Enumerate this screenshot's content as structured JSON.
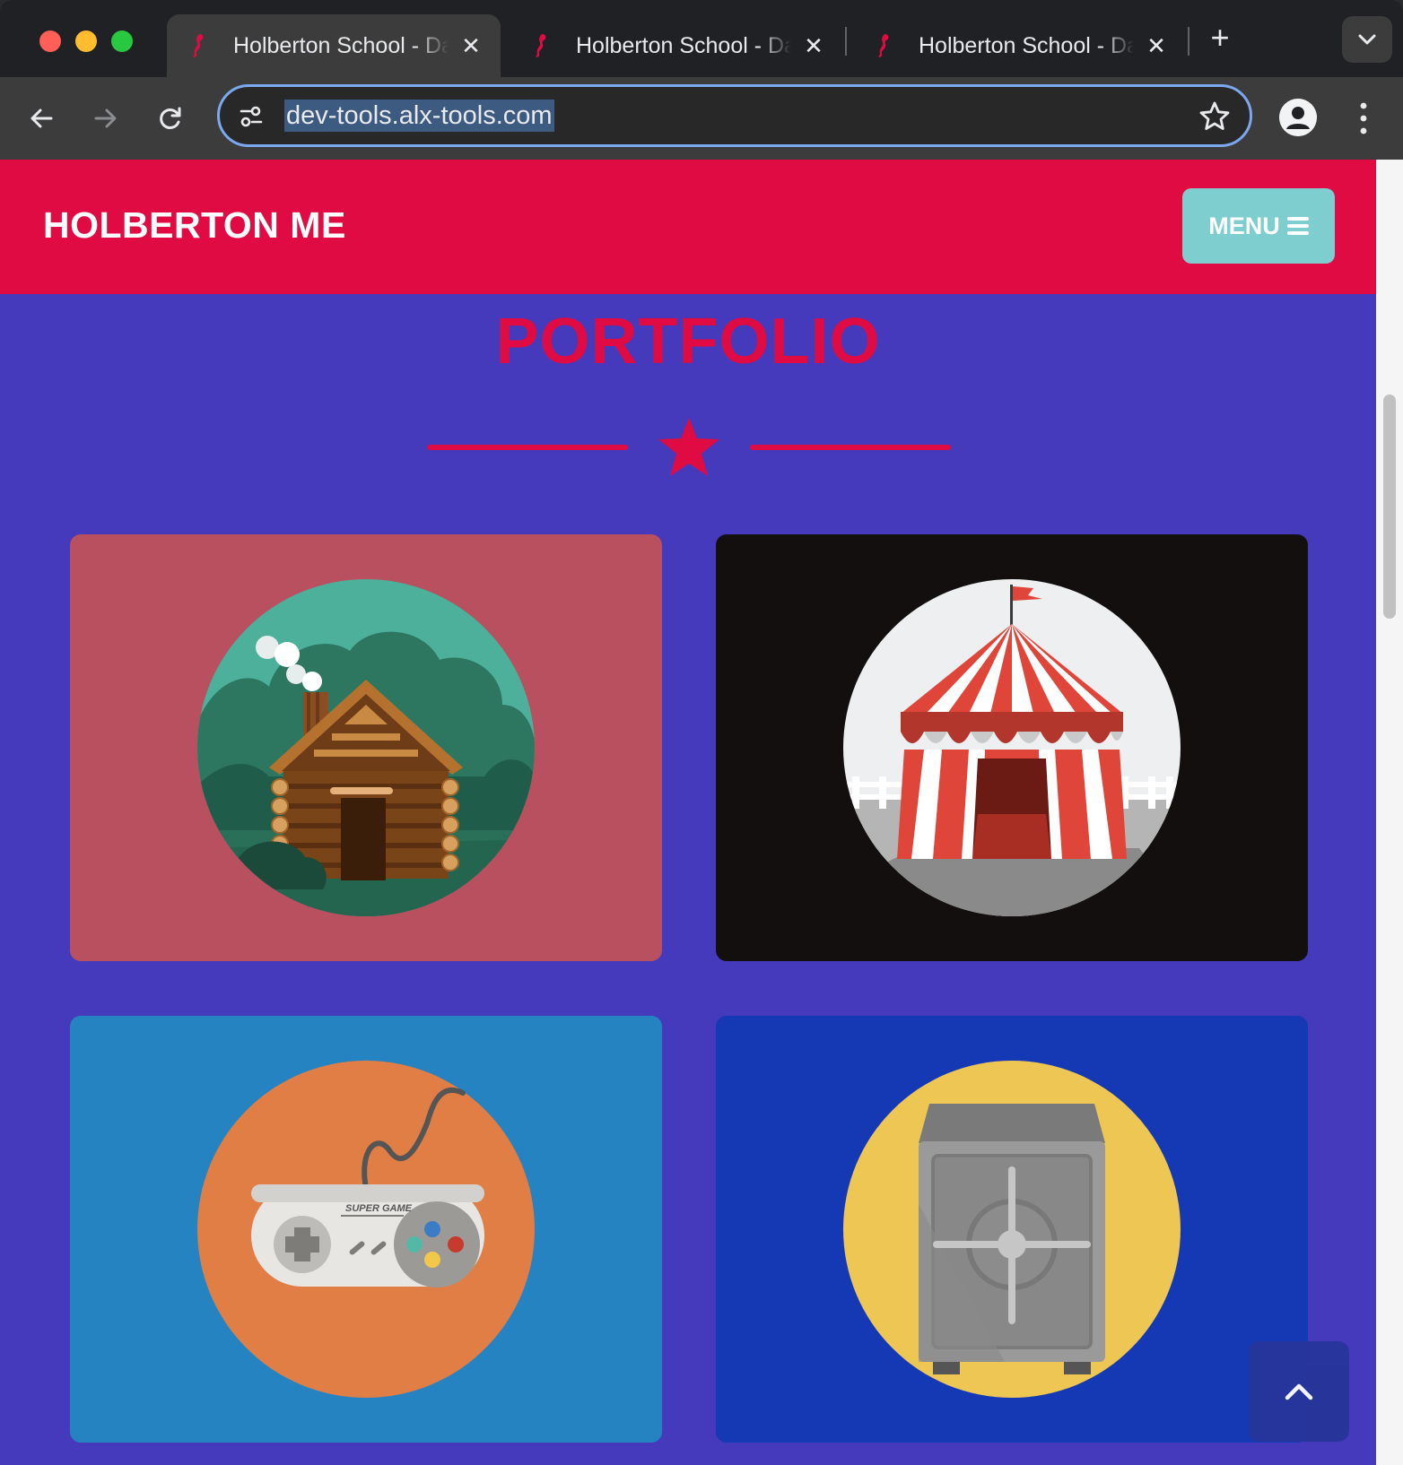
{
  "browser": {
    "tabs": [
      {
        "title": "Holberton School - Dashboard",
        "active": true
      },
      {
        "title": "Holberton School - Dashboard",
        "active": false
      },
      {
        "title": "Holberton School - Dashboard",
        "active": false
      }
    ],
    "address": {
      "url": "dev-tools.alx-tools.com"
    }
  },
  "site": {
    "brand": "HOLBERTON ME",
    "menu_label": "MENU",
    "section_title": "PORTFOLIO",
    "portfolio_items": [
      {
        "name": "log-cabin",
        "background": "#b8505f"
      },
      {
        "name": "circus-tent",
        "background": "#120f0e"
      },
      {
        "name": "game-controller",
        "background": "#2583c2",
        "controller_text": "SUPER GAME"
      },
      {
        "name": "safe",
        "background": "#1539b4"
      }
    ]
  },
  "colors": {
    "primary_red": "#e00b43",
    "page_background": "#4539bc",
    "menu_button": "#7ecdcf",
    "back_to_top": "#26359a"
  },
  "icons": [
    "favicon-seahorse-icon",
    "close-icon",
    "plus-icon",
    "chevron-down-icon",
    "back-arrow-icon",
    "forward-arrow-icon",
    "reload-icon",
    "tune-icon",
    "bookmark-star-icon",
    "profile-icon",
    "more-vertical-icon",
    "hamburger-icon",
    "star-icon",
    "chevron-up-icon"
  ]
}
